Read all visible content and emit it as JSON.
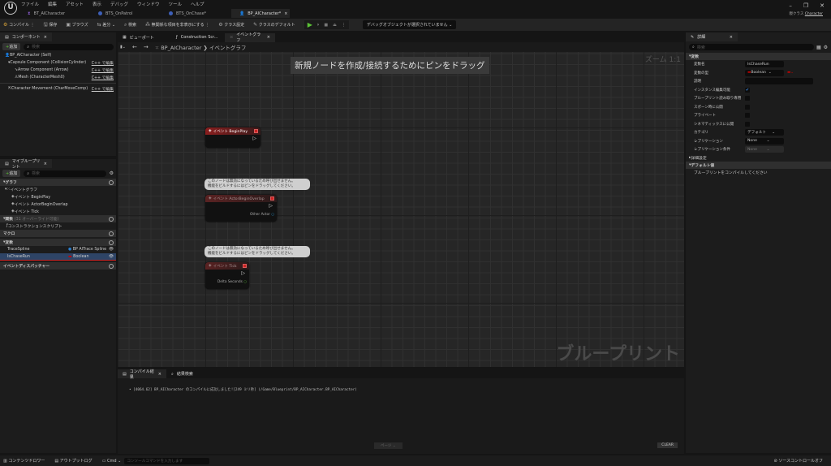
{
  "menu": [
    "ファイル",
    "編集",
    "アセット",
    "表示",
    "デバッグ",
    "ウィンドウ",
    "ツール",
    "ヘルプ"
  ],
  "doc_tabs": [
    "BT_AICharacter",
    "BTS_OnPatrol",
    "BTS_OnChase*",
    "BP_AICharacter*"
  ],
  "parent_class": {
    "label": "親クラス",
    "value": "Character"
  },
  "toolbar": {
    "compile": "コンパイル",
    "save": "保存",
    "browse": "ブラウズ",
    "diff": "差分",
    "find": "検索",
    "hide_unrelated": "無関係な項目を非表示にする",
    "class_settings": "クラス設定",
    "class_defaults": "クラスのデフォルト",
    "debug_object": "デバッグオブジェクトが選択されていません"
  },
  "components": {
    "tab": "コンポーネント",
    "add": "追加",
    "search_placeholder": "検索",
    "items": [
      {
        "label": "BP_AICharacter (Self)"
      },
      {
        "label": "Capsule Component (CollisionCylinder)",
        "edit": "C++ で編集"
      },
      {
        "label": "Arrow Component (Arrow)",
        "edit": "C++ で編集"
      },
      {
        "label": "Mesh (CharacterMesh0)",
        "edit": "C++ で編集"
      },
      {
        "label": "Character Movement (CharMoveComp)",
        "edit": "C++ で編集"
      }
    ]
  },
  "my_blueprint": {
    "tab": "マイブループリント",
    "add": "追加",
    "search_placeholder": "検索",
    "graphs_header": "グラフ",
    "event_graph": "イベントグラフ",
    "events": [
      "イベント BeginPlay",
      "イベント ActorBeginOverlap",
      "イベント Tick"
    ],
    "functions_header": "関数",
    "functions_note": "(31 オーバーライド可能)",
    "construction_script": "コンストラクションスクリプト",
    "macros_header": "マクロ",
    "variables_header": "変数",
    "variables": [
      {
        "name": "TraceSpline",
        "type": "BP AITrace Spline"
      },
      {
        "name": "IsChaseRun",
        "type": "Boolean"
      }
    ],
    "dispatchers_header": "イベントディスパッチャー"
  },
  "graph_tabs": [
    "ビューポート",
    "Construction Scr...",
    "イベントグラフ"
  ],
  "breadcrumb": {
    "root": "BP_AICharacter",
    "current": "イベントグラフ"
  },
  "graph": {
    "hint": "新規ノードを作成/接続するためにピンをドラッグ",
    "zoom": "ズーム 1:1",
    "watermark": "ブループリント",
    "nodes": [
      {
        "title": "イベント BeginPlay"
      },
      {
        "title": "イベント ActorBeginOverlap",
        "pin": "Other Actor",
        "comment": "このノードは無効になっているため呼び出せません。\n機能をビルドするにはピンをドラッグしてください。"
      },
      {
        "title": "イベント Tick",
        "pin": "Delta Seconds",
        "comment": "このノードは無効になっているため呼び出せません。\n機能をビルドするにはピンをドラッグしてください。"
      }
    ]
  },
  "results": {
    "tab": "コンパイル結果",
    "find_tab": "結果検索",
    "log": "[4064.62] BP_AICharacter のコンパイルに成功しました![249 ミリ秒] (/Game/Blueprint/BP_AICharacter.BP_AICharacter)",
    "page": "ページ",
    "clear": "CLEAR"
  },
  "details": {
    "tab": "詳細",
    "search_placeholder": "検索",
    "variable_section": "変数",
    "rows": [
      {
        "label": "変数名",
        "value": "IsChaseRun"
      },
      {
        "label": "変数の型",
        "value": "Boolean"
      },
      {
        "label": "説明",
        "value": ""
      },
      {
        "label": "インスタンス編集可能",
        "checked": true
      },
      {
        "label": "ブループリント読み取り専用",
        "checked": false
      },
      {
        "label": "スポーン時に公開",
        "checked": false
      },
      {
        "label": "プライベート",
        "checked": false
      },
      {
        "label": "シネマティックスに公開",
        "checked": false
      },
      {
        "label": "カテゴリ",
        "value": "デフォルト"
      },
      {
        "label": "レプリケーション",
        "value": "None"
      },
      {
        "label": "レプリケーション条件",
        "value": "None"
      }
    ],
    "advanced": "詳細設定",
    "default_section": "デフォルト値",
    "default_note": "ブループリントをコンパイルしてください"
  },
  "statusbar": {
    "content_drawer": "コンテンツドロワー",
    "output_log": "アウトプットログ",
    "cmd": "Cmd",
    "console_placeholder": "コンソールコマンドを入力します",
    "source_control": "ソースコントロールオフ"
  },
  "colors": {
    "accent_green": "#5bc236",
    "boolean": "#a00000",
    "event_red": "#8a1e1e"
  }
}
